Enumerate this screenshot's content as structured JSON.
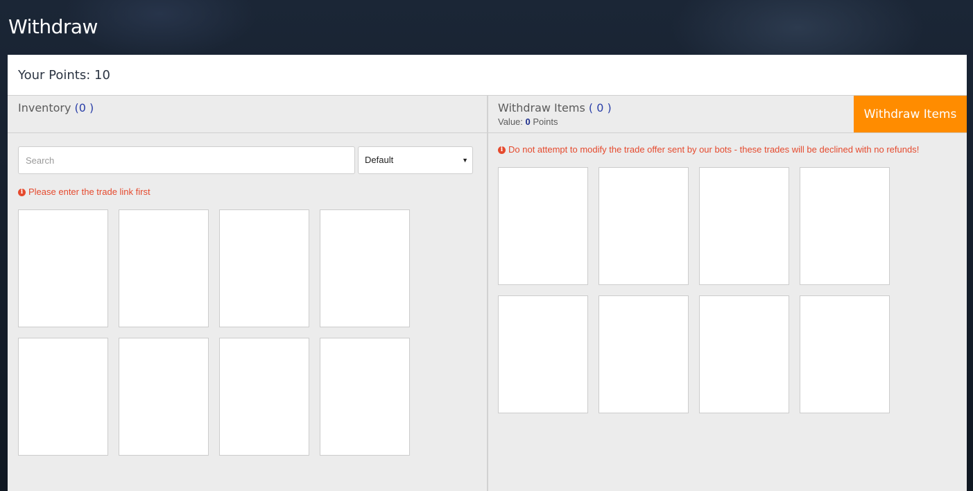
{
  "header": {
    "title": "Withdraw"
  },
  "points": {
    "label": "Your Points:",
    "value": "10"
  },
  "inventory": {
    "title": "Inventory",
    "count_open": "(",
    "count": "0",
    "count_close": ")",
    "search_placeholder": "Search",
    "sort_selected": "Default",
    "alert": "Please enter the trade link first",
    "slots": [
      1,
      2,
      3,
      4,
      5,
      6,
      7,
      8
    ]
  },
  "withdraw": {
    "title": "Withdraw Items",
    "count_open": "(",
    "count": "0",
    "count_close": ")",
    "value_label": "Value:",
    "value": "0",
    "value_unit": "Points",
    "button_label": "Withdraw Items",
    "alert": "Do not attempt to modify the trade offer sent by our bots - these trades will be declined with no refunds!",
    "slots": [
      1,
      2,
      3,
      4,
      5,
      6,
      7,
      8
    ]
  },
  "colors": {
    "accent": "#ff8c00",
    "alert": "#e54a2e",
    "count": "#2a3fa8",
    "panel": "#ececec"
  }
}
